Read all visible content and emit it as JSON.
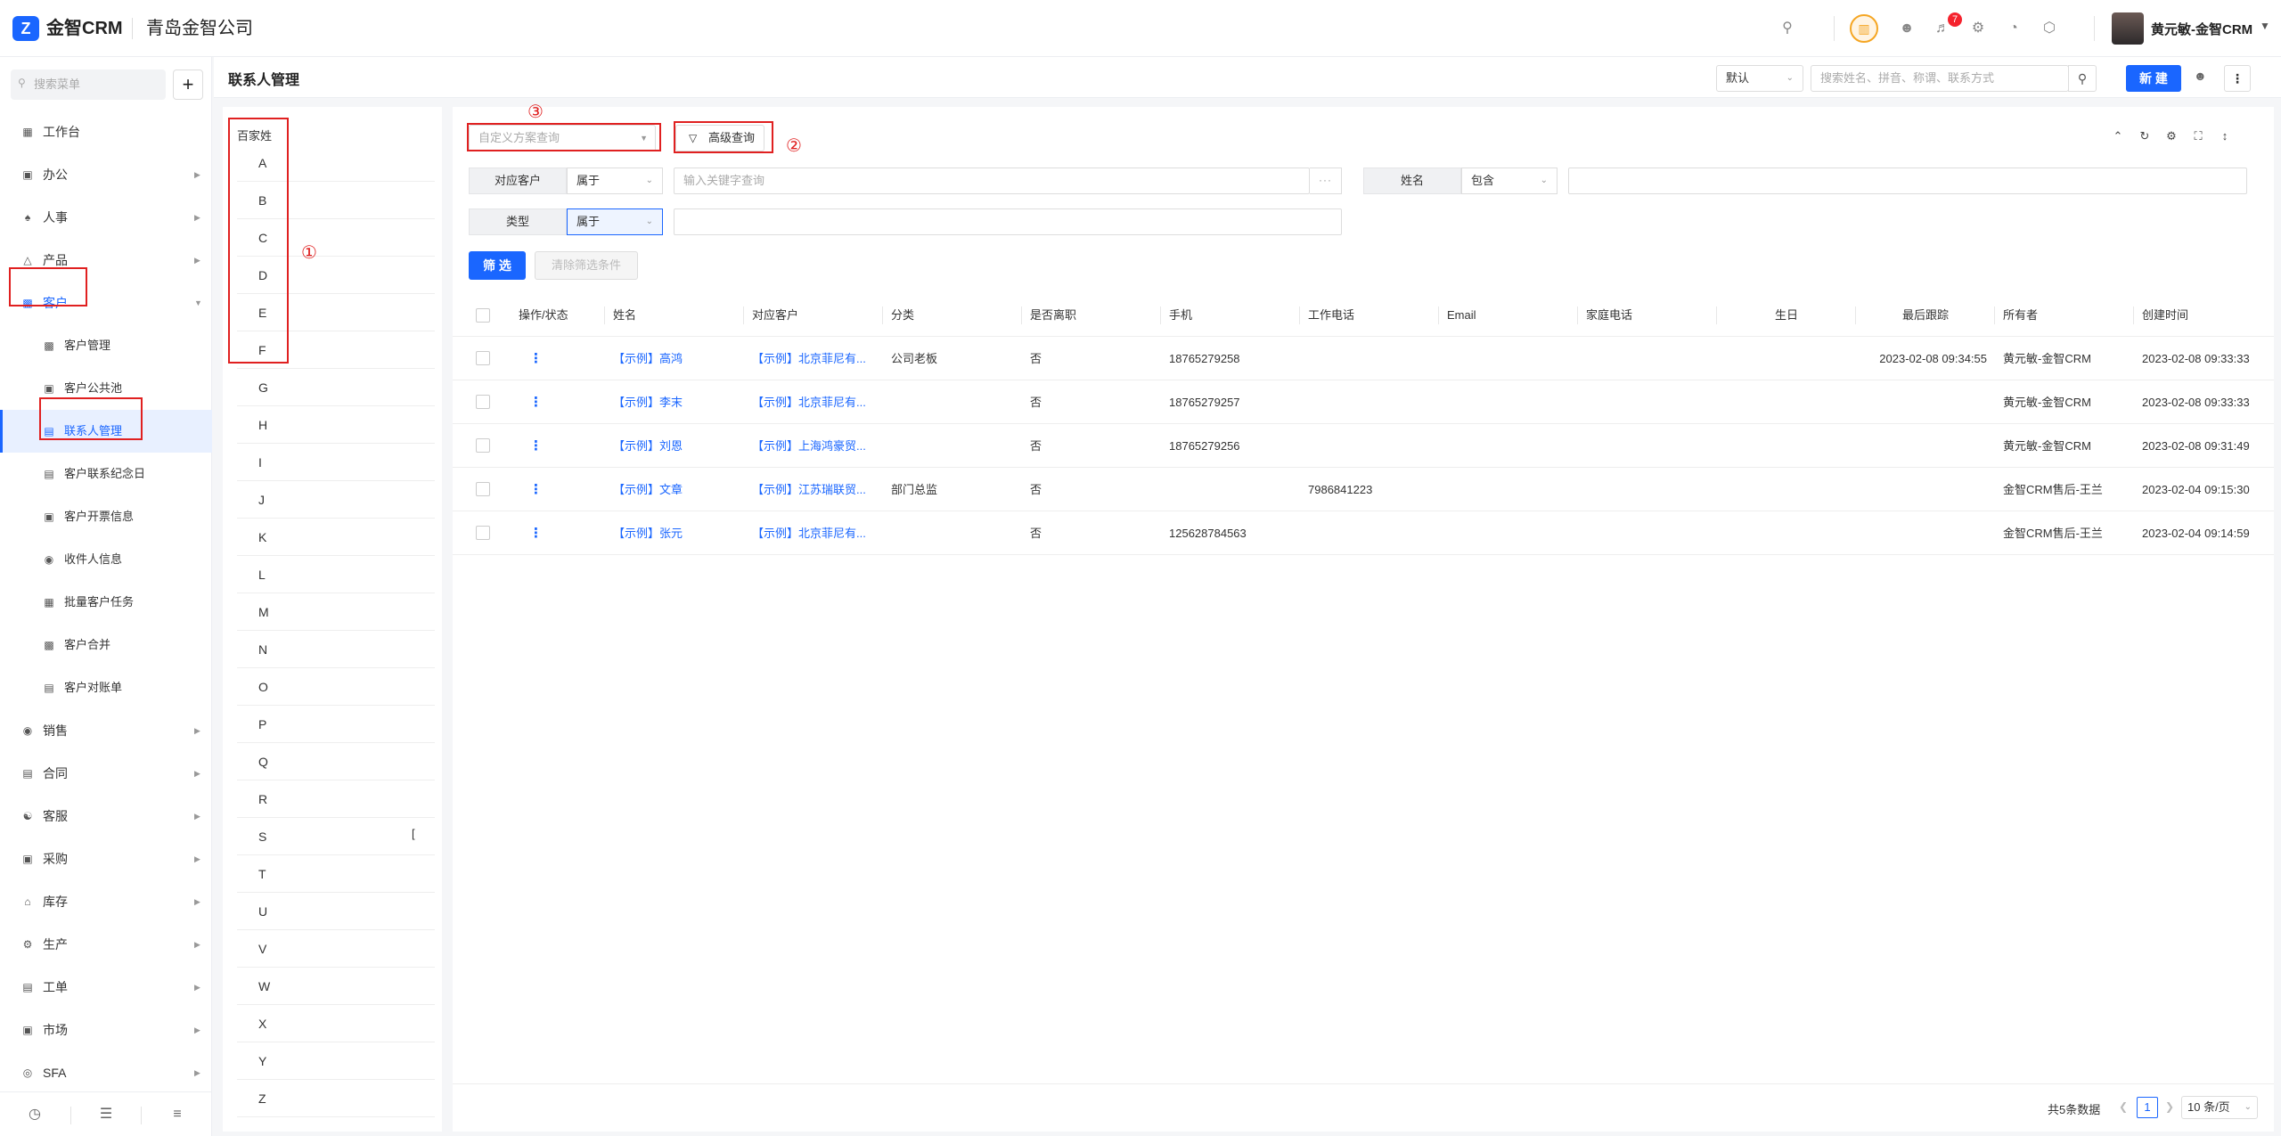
{
  "header": {
    "brand": "金智CRM",
    "company": "青岛金智公司",
    "notification_count": "7",
    "user_name": "黄元敏-金智CRM",
    "icons": [
      "search-icon",
      "crm-badge-icon",
      "contacts-icon",
      "bell-icon",
      "gear-icon",
      "pie-chart-icon",
      "cube-icon"
    ]
  },
  "sidebar": {
    "search_placeholder": "搜索菜单",
    "items": [
      {
        "label": "工作台",
        "icon": "dashboard-icon"
      },
      {
        "label": "办公",
        "icon": "office-icon"
      },
      {
        "label": "人事",
        "icon": "people-icon"
      },
      {
        "label": "产品",
        "icon": "product-icon"
      },
      {
        "label": "客户",
        "icon": "customer-icon"
      },
      {
        "label": "客户管理",
        "icon": "chart-icon"
      },
      {
        "label": "客户公共池",
        "icon": "pool-icon"
      },
      {
        "label": "联系人管理",
        "icon": "contact-card-icon"
      },
      {
        "label": "客户联系纪念日",
        "icon": "calendar-icon"
      },
      {
        "label": "客户开票信息",
        "icon": "invoice-icon"
      },
      {
        "label": "收件人信息",
        "icon": "recipient-icon"
      },
      {
        "label": "批量客户任务",
        "icon": "task-icon"
      },
      {
        "label": "客户合并",
        "icon": "merge-icon"
      },
      {
        "label": "客户对账单",
        "icon": "statement-icon"
      },
      {
        "label": "销售",
        "icon": "sales-icon"
      },
      {
        "label": "合同",
        "icon": "contract-icon"
      },
      {
        "label": "客服",
        "icon": "service-icon"
      },
      {
        "label": "采购",
        "icon": "purchase-icon"
      },
      {
        "label": "库存",
        "icon": "warehouse-icon"
      },
      {
        "label": "生产",
        "icon": "production-icon"
      },
      {
        "label": "工单",
        "icon": "workorder-icon"
      },
      {
        "label": "市场",
        "icon": "market-icon"
      },
      {
        "label": "SFA",
        "icon": "sfa-icon"
      }
    ]
  },
  "page": {
    "title": "联系人管理",
    "view_select": "默认",
    "search_placeholder": "搜索姓名、拼音、称谓、联系方式",
    "new_label": "新 建"
  },
  "alphabet": {
    "title": "百家姓",
    "letters": [
      "A",
      "B",
      "C",
      "D",
      "E",
      "F",
      "G",
      "H",
      "I",
      "J",
      "K",
      "L",
      "M",
      "N",
      "O",
      "P",
      "Q",
      "R",
      "S",
      "T",
      "U",
      "V",
      "W",
      "X",
      "Y",
      "Z"
    ]
  },
  "filters": {
    "scheme_placeholder": "自定义方案查询",
    "advanced_label": "高级查询",
    "customer_label": "对应客户",
    "customer_op": "属于",
    "customer_placeholder": "输入关键字查询",
    "ellipsis": "···",
    "name_label": "姓名",
    "name_op": "包含",
    "type_label": "类型",
    "type_op": "属于",
    "filter_label": "筛 选",
    "clear_label": "清除筛选条件"
  },
  "annotations": {
    "one": "①",
    "two": "②",
    "three": "③"
  },
  "table": {
    "headers": [
      "操作/状态",
      "姓名",
      "对应客户",
      "分类",
      "是否离职",
      "手机",
      "工作电话",
      "Email",
      "家庭电话",
      "生日",
      "最后跟踪",
      "所有者",
      "创建时间"
    ],
    "rows": [
      {
        "name": "【示例】高鸿",
        "customer": "【示例】北京菲尼有...",
        "category": "公司老板",
        "resigned": "否",
        "mobile": "18765279258",
        "work_phone": "",
        "email": "",
        "home_phone": "",
        "birthday": "",
        "last_track": "2023-02-08 09:34:55",
        "owner": "黄元敏-金智CRM",
        "created": "2023-02-08 09:33:33"
      },
      {
        "name": "【示例】李末",
        "customer": "【示例】北京菲尼有...",
        "category": "",
        "resigned": "否",
        "mobile": "18765279257",
        "work_phone": "",
        "email": "",
        "home_phone": "",
        "birthday": "",
        "last_track": "",
        "owner": "黄元敏-金智CRM",
        "created": "2023-02-08 09:33:33"
      },
      {
        "name": "【示例】刘恩",
        "customer": "【示例】上海鸿豪贸...",
        "category": "",
        "resigned": "否",
        "mobile": "18765279256",
        "work_phone": "",
        "email": "",
        "home_phone": "",
        "birthday": "",
        "last_track": "",
        "owner": "黄元敏-金智CRM",
        "created": "2023-02-08 09:31:49"
      },
      {
        "name": "【示例】文章",
        "customer": "【示例】江苏瑞联贸...",
        "category": "部门总监",
        "resigned": "否",
        "mobile": "",
        "work_phone": "7986841223",
        "email": "",
        "home_phone": "",
        "birthday": "",
        "last_track": "",
        "owner": "金智CRM售后-王兰",
        "created": "2023-02-04 09:15:30"
      },
      {
        "name": "【示例】张元",
        "customer": "【示例】北京菲尼有...",
        "category": "",
        "resigned": "否",
        "mobile": "125628784563",
        "work_phone": "",
        "email": "",
        "home_phone": "",
        "birthday": "",
        "last_track": "",
        "owner": "金智CRM售后-王兰",
        "created": "2023-02-04 09:14:59"
      }
    ]
  },
  "pagination": {
    "total": "共5条数据",
    "current": "1",
    "page_size": "10 条/页"
  },
  "colors": {
    "accent": "#1a66ff",
    "annotation": "#e02020"
  }
}
